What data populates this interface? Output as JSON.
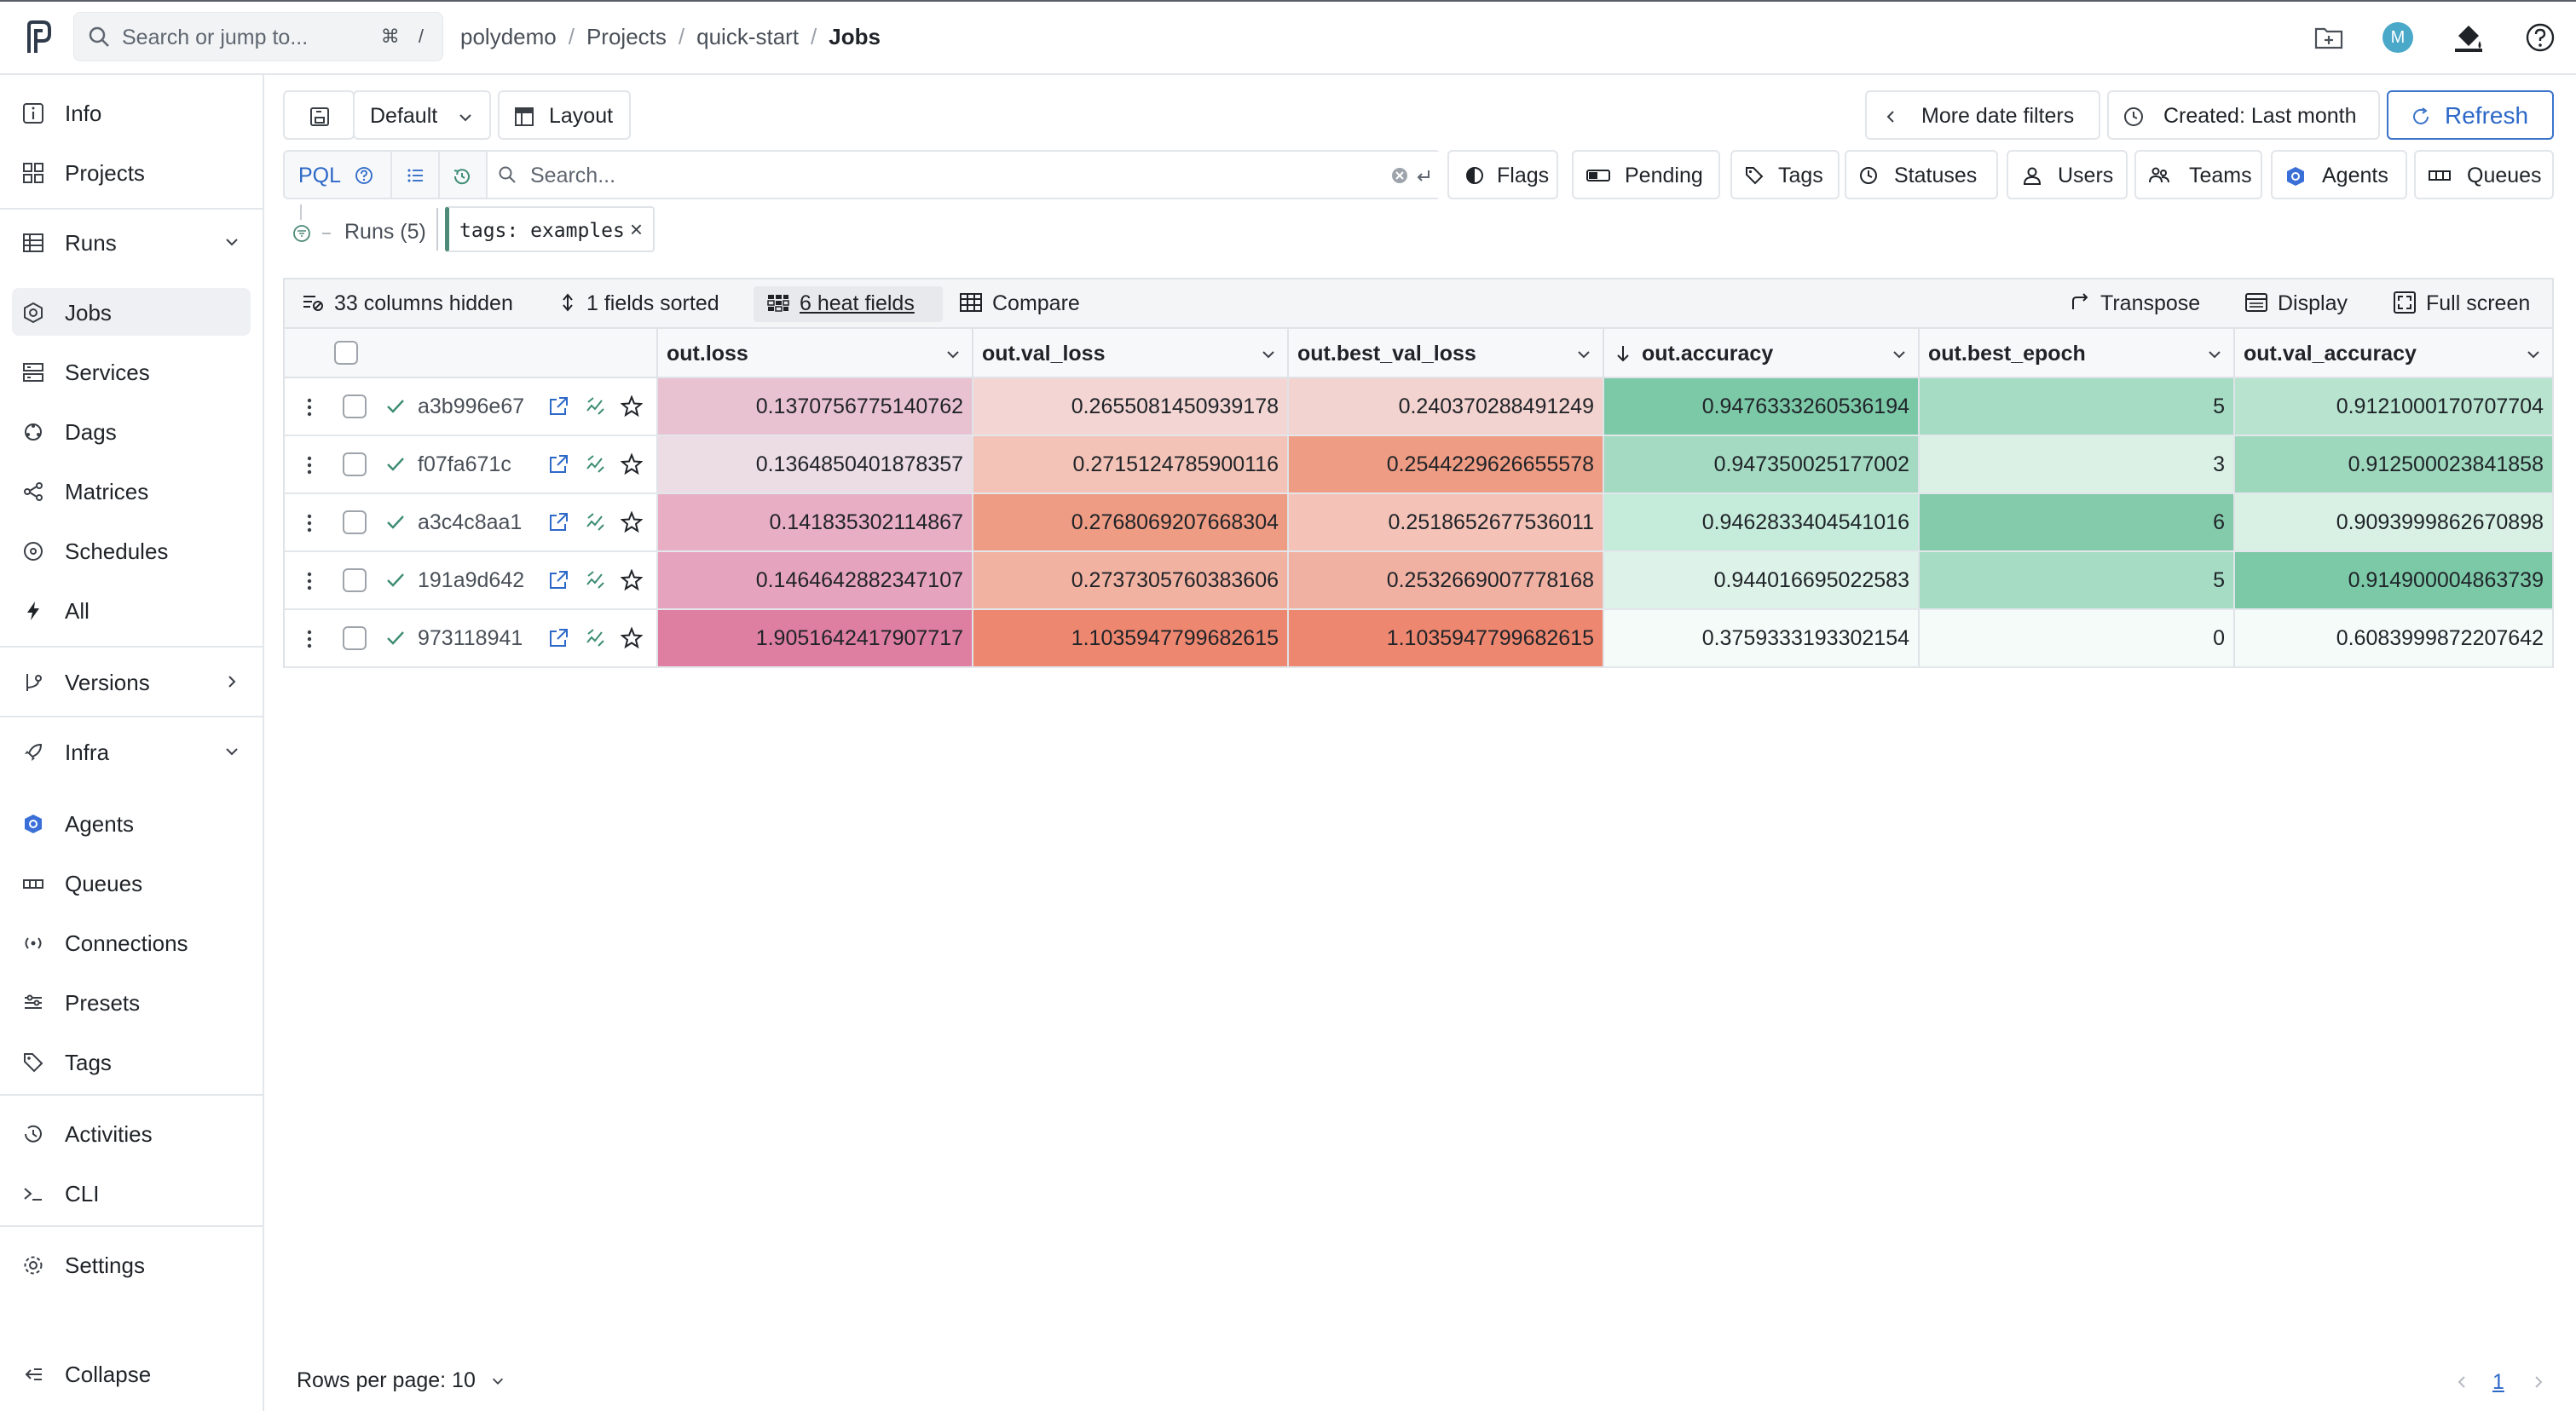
{
  "topbar": {
    "search_placeholder": "Search or jump to...",
    "search_shortcut": "⌘ /",
    "breadcrumbs": [
      "polydemo",
      "Projects",
      "quick-start",
      "Jobs"
    ],
    "avatar_initial": "M"
  },
  "sidebar": {
    "items": [
      {
        "label": "Info",
        "icon": "info-icon"
      },
      {
        "label": "Projects",
        "icon": "grid-icon"
      },
      {
        "label": "Runs",
        "icon": "table-icon",
        "expand": "down"
      },
      {
        "label": "Jobs",
        "icon": "jobs-icon",
        "active": true
      },
      {
        "label": "Services",
        "icon": "server-icon"
      },
      {
        "label": "Dags",
        "icon": "dag-icon"
      },
      {
        "label": "Matrices",
        "icon": "matrix-icon"
      },
      {
        "label": "Schedules",
        "icon": "schedule-icon"
      },
      {
        "label": "All",
        "icon": "bolt-icon"
      },
      {
        "label": "Versions",
        "icon": "versions-icon",
        "expand": "right"
      },
      {
        "label": "Infra",
        "icon": "rocket-icon",
        "expand": "down"
      },
      {
        "label": "Agents",
        "icon": "agent-icon"
      },
      {
        "label": "Queues",
        "icon": "queue-icon"
      },
      {
        "label": "Connections",
        "icon": "connection-icon"
      },
      {
        "label": "Presets",
        "icon": "preset-icon"
      },
      {
        "label": "Tags",
        "icon": "tag-icon"
      },
      {
        "label": "Activities",
        "icon": "history-icon"
      },
      {
        "label": "CLI",
        "icon": "terminal-icon"
      },
      {
        "label": "Settings",
        "icon": "gear-icon"
      },
      {
        "label": "Collapse",
        "icon": "collapse-icon"
      }
    ]
  },
  "toolbar": {
    "default_label": "Default",
    "layout_label": "Layout",
    "more_date_filters": "More date filters",
    "created_label": "Created: Last month",
    "refresh_label": "Refresh"
  },
  "filters": {
    "pql_label": "PQL",
    "search_placeholder": "Search...",
    "chips": [
      "Flags",
      "Pending",
      "Tags",
      "Statuses",
      "Users",
      "Teams",
      "Agents",
      "Queues"
    ]
  },
  "runs": {
    "label": "Runs (5)",
    "tag_filter": "tags: examples"
  },
  "table_toolbar": {
    "hidden": "33 columns hidden",
    "sorted": "1 fields sorted",
    "heat": "6 heat fields",
    "compare": "Compare",
    "transpose": "Transpose",
    "display": "Display",
    "fullscreen": "Full screen"
  },
  "table": {
    "columns": [
      "out.loss",
      "out.val_loss",
      "out.best_val_loss",
      "out.accuracy",
      "out.best_epoch",
      "out.val_accuracy"
    ],
    "rows": [
      {
        "id": "a3b996e67",
        "status": "succeeded",
        "values": [
          "0.1370756775140762",
          "0.2655081450939178",
          "0.240370288491249",
          "0.9476333260536194",
          "5",
          "0.9121000170707704"
        ],
        "colors": [
          "#e9c2d1",
          "#f3d6d3",
          "#f3d3cf",
          "#7cc9a8",
          "#a6dcc4",
          "#b7e3cf"
        ]
      },
      {
        "id": "f07fa671c",
        "status": "succeeded",
        "values": [
          "0.1364850401878357",
          "0.2715124785900116",
          "0.2544229626655578",
          "0.947350025177002",
          "3",
          "0.912500023841858"
        ],
        "colors": [
          "#ecdce3",
          "#f4c3b7",
          "#ef9c84",
          "#a3dac1",
          "#dbf1e6",
          "#9dd8bd"
        ]
      },
      {
        "id": "a3c4c8aa1",
        "status": "succeeded",
        "values": [
          "0.141835302114867",
          "0.2768069207668304",
          "0.2518652677536011",
          "0.9462833404541016",
          "6",
          "0.9093999862670898"
        ],
        "colors": [
          "#e8aec4",
          "#ef9c84",
          "#f4c2b7",
          "#c5ebda",
          "#84cbab",
          "#d9f1e5"
        ]
      },
      {
        "id": "191a9d642",
        "status": "succeeded",
        "values": [
          "0.1464642882347107",
          "0.2737305760383606",
          "0.2532669007778168",
          "0.944016695022583",
          "5",
          "0.914900004863739"
        ],
        "colors": [
          "#e6a3bd",
          "#f2b2a2",
          "#f1b1a2",
          "#ddf2e8",
          "#a6dcc4",
          "#7cc9a8"
        ]
      },
      {
        "id": "973118941",
        "status": "succeeded",
        "values": [
          "1.9051642417907717",
          "1.1035947799682615",
          "1.1035947799682615",
          "0.3759333193302154",
          "0",
          "0.6083999872207642"
        ],
        "colors": [
          "#de7ea0",
          "#ee8770",
          "#ee8770",
          "#f5fbf8",
          "#f5fbf8",
          "#f5fbf8"
        ]
      }
    ]
  },
  "footer": {
    "rows_per_page": "Rows per page: 10",
    "page": "1"
  }
}
